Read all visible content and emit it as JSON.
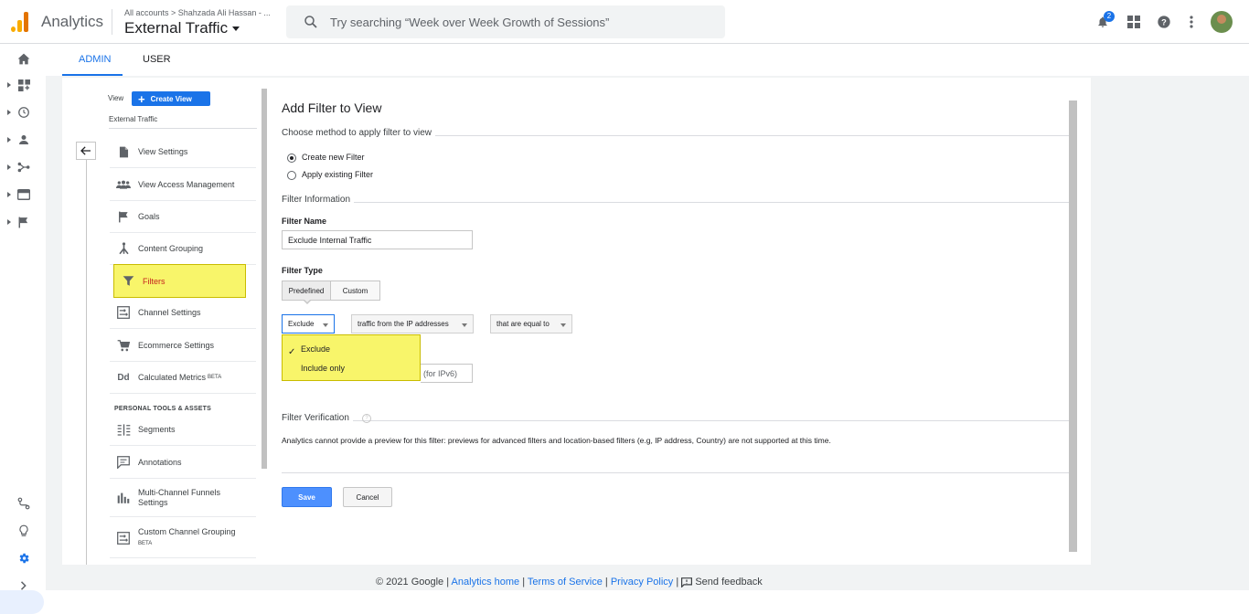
{
  "app": {
    "name": "Analytics",
    "breadcrumb": "All accounts > Shahzada Ali Hassan - ...",
    "property": "External Traffic"
  },
  "search": {
    "placeholder": "Try searching “Week over Week Growth of Sessions”"
  },
  "top_icons": {
    "notifications_badge": "2"
  },
  "tabs": {
    "admin": "ADMIN",
    "user": "USER"
  },
  "sidebar": {
    "view_label": "View",
    "create_view": "Create View",
    "view_name": "External Traffic",
    "items": [
      {
        "label": "View Settings",
        "icon": "document-icon"
      },
      {
        "label": "View Access Management",
        "icon": "people-icon"
      },
      {
        "label": "Goals",
        "icon": "flag-icon"
      },
      {
        "label": "Content Grouping",
        "icon": "grouping-icon"
      },
      {
        "label": "Filters",
        "icon": "filter-icon"
      },
      {
        "label": "Channel Settings",
        "icon": "channel-icon"
      },
      {
        "label": "Ecommerce Settings",
        "icon": "cart-icon"
      },
      {
        "label": "Calculated Metrics",
        "beta": "BETA",
        "icon": "dd-icon"
      }
    ],
    "section_title": "PERSONAL TOOLS & ASSETS",
    "personal_items": [
      {
        "label": "Segments",
        "icon": "segments-icon"
      },
      {
        "label": "Annotations",
        "icon": "annotation-icon"
      },
      {
        "label": "Multi-Channel Funnels",
        "label2": "Settings",
        "icon": "bars-icon"
      },
      {
        "label": "Custom Channel Grouping",
        "beta": "BETA",
        "icon": "channel-icon"
      }
    ]
  },
  "form": {
    "title": "Add Filter to View",
    "method_legend": "Choose method to apply filter to view",
    "radio_new": "Create new Filter",
    "radio_existing": "Apply existing Filter",
    "info_legend": "Filter Information",
    "filter_name_label": "Filter Name",
    "filter_name_value": "Exclude Internal Traffic",
    "filter_type_label": "Filter Type",
    "type_predefined": "Predefined",
    "type_custom": "Custom",
    "dd_action": "Exclude",
    "dd_source": "traffic from the IP addresses",
    "dd_expression": "that are equal to",
    "options": [
      "Exclude",
      "Include only"
    ],
    "ipv6_hint": "(for IPv6)",
    "verification_legend": "Filter Verification",
    "verification_help": "?",
    "verification_text": "Analytics cannot provide a preview for this filter: previews for advanced filters and location-based filters (e.g, IP address, Country) are not supported at this time.",
    "save": "Save",
    "cancel": "Cancel"
  },
  "footer": {
    "copyright": "© 2021 Google",
    "sep": "|",
    "analytics_home": "Analytics home",
    "terms": "Terms of Service",
    "privacy": "Privacy Policy",
    "feedback": "Send feedback"
  },
  "colors": {
    "accent": "#1a73e8",
    "highlight": "#f8f56a",
    "save_button": "#4d90fe"
  }
}
